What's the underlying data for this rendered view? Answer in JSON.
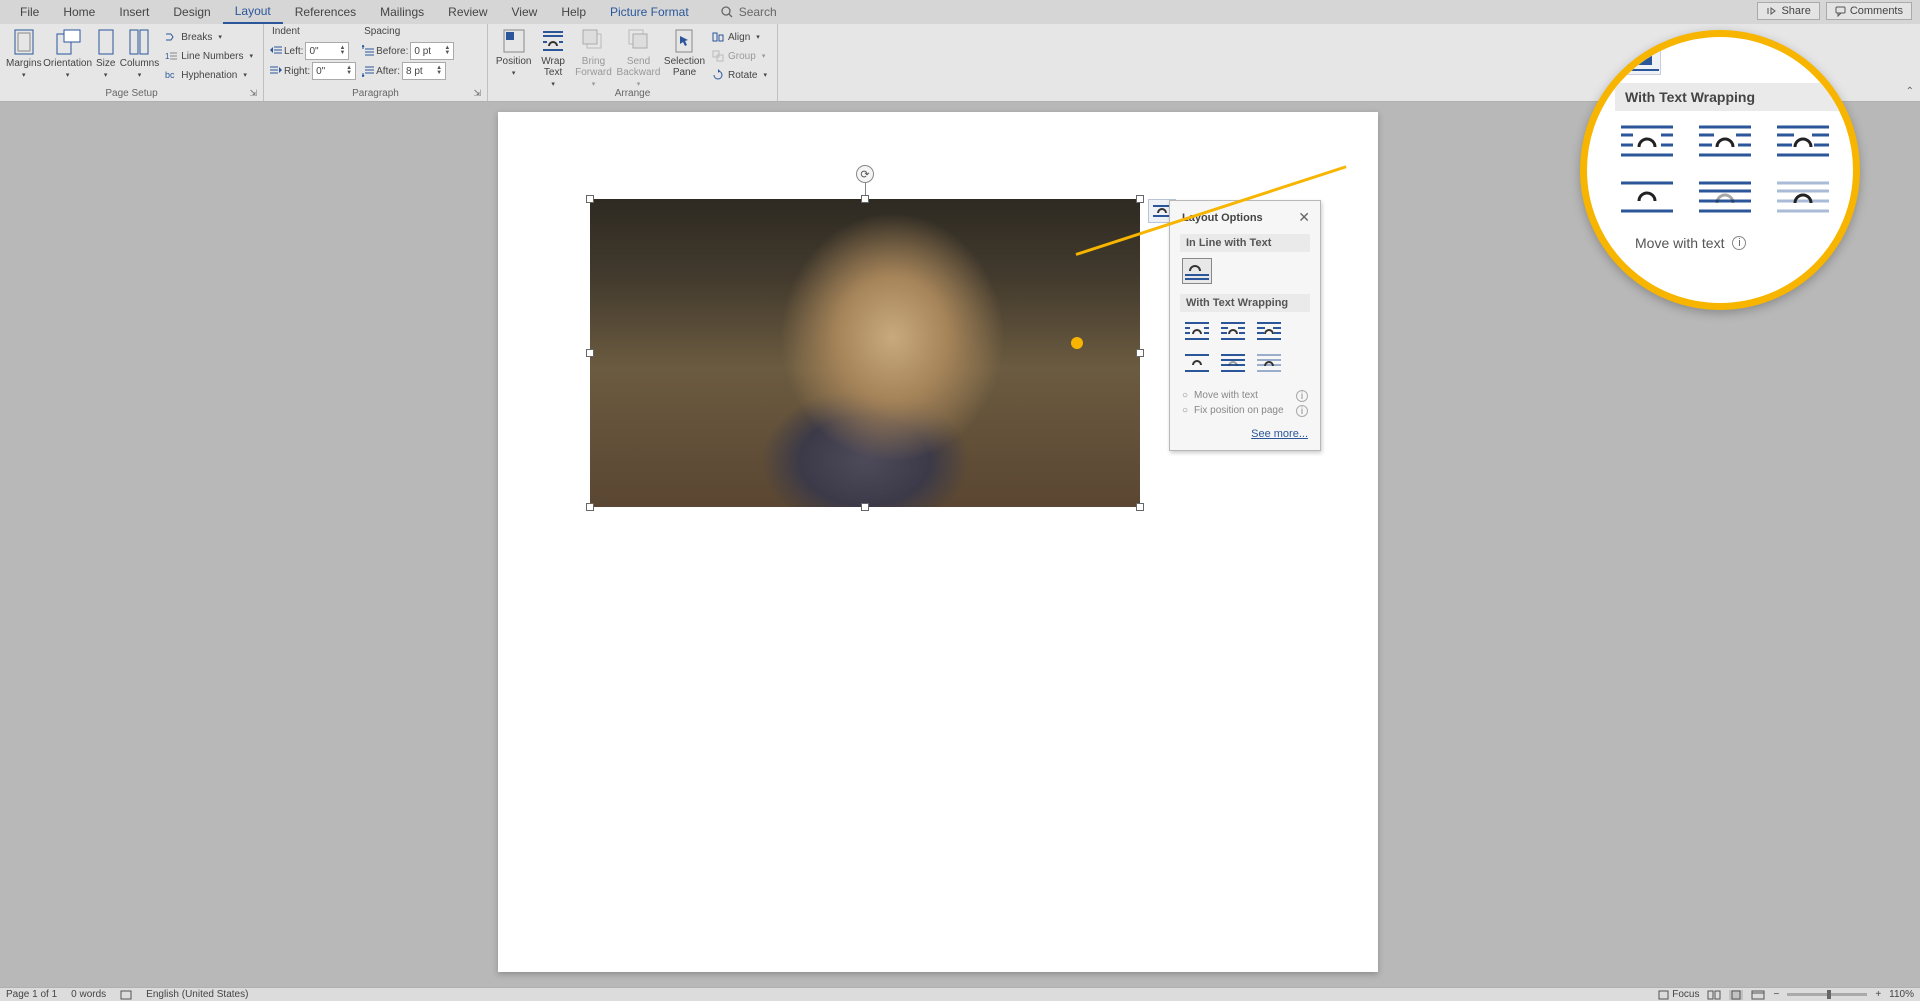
{
  "tabs": {
    "file": "File",
    "home": "Home",
    "insert": "Insert",
    "design": "Design",
    "layout": "Layout",
    "references": "References",
    "mailings": "Mailings",
    "review": "Review",
    "view": "View",
    "help": "Help",
    "picture_format": "Picture Format"
  },
  "search_placeholder": "Search",
  "topright": {
    "share": "Share",
    "comments": "Comments"
  },
  "page_setup": {
    "margins": "Margins",
    "orientation": "Orientation",
    "size": "Size",
    "columns": "Columns",
    "breaks": "Breaks",
    "line_numbers": "Line Numbers",
    "hyphenation": "Hyphenation",
    "label": "Page Setup"
  },
  "paragraph_group": {
    "indent_label": "Indent",
    "spacing_label": "Spacing",
    "left_label": "Left:",
    "right_label": "Right:",
    "before_label": "Before:",
    "after_label": "After:",
    "left_val": "0\"",
    "right_val": "0\"",
    "before_val": "0 pt",
    "after_val": "8 pt",
    "label": "Paragraph"
  },
  "arrange_group": {
    "position": "Position",
    "wrap_text": "Wrap Text",
    "bring_forward": "Bring Forward",
    "send_backward": "Send Backward",
    "selection_pane": "Selection Pane",
    "align": "Align",
    "group": "Group",
    "rotate": "Rotate",
    "label": "Arrange"
  },
  "layout_options": {
    "title": "Layout Options",
    "inline_title": "In Line with Text",
    "wrap_title": "With Text Wrapping",
    "move_with_text": "Move with text",
    "fix_position": "Fix position on page",
    "see_more": "See more..."
  },
  "callout": {
    "title": "With Text Wrapping",
    "move_with_text": "Move with text"
  },
  "status": {
    "page": "Page 1 of 1",
    "words": "0 words",
    "lang": "English (United States)",
    "focus": "Focus",
    "zoom": "110%"
  }
}
